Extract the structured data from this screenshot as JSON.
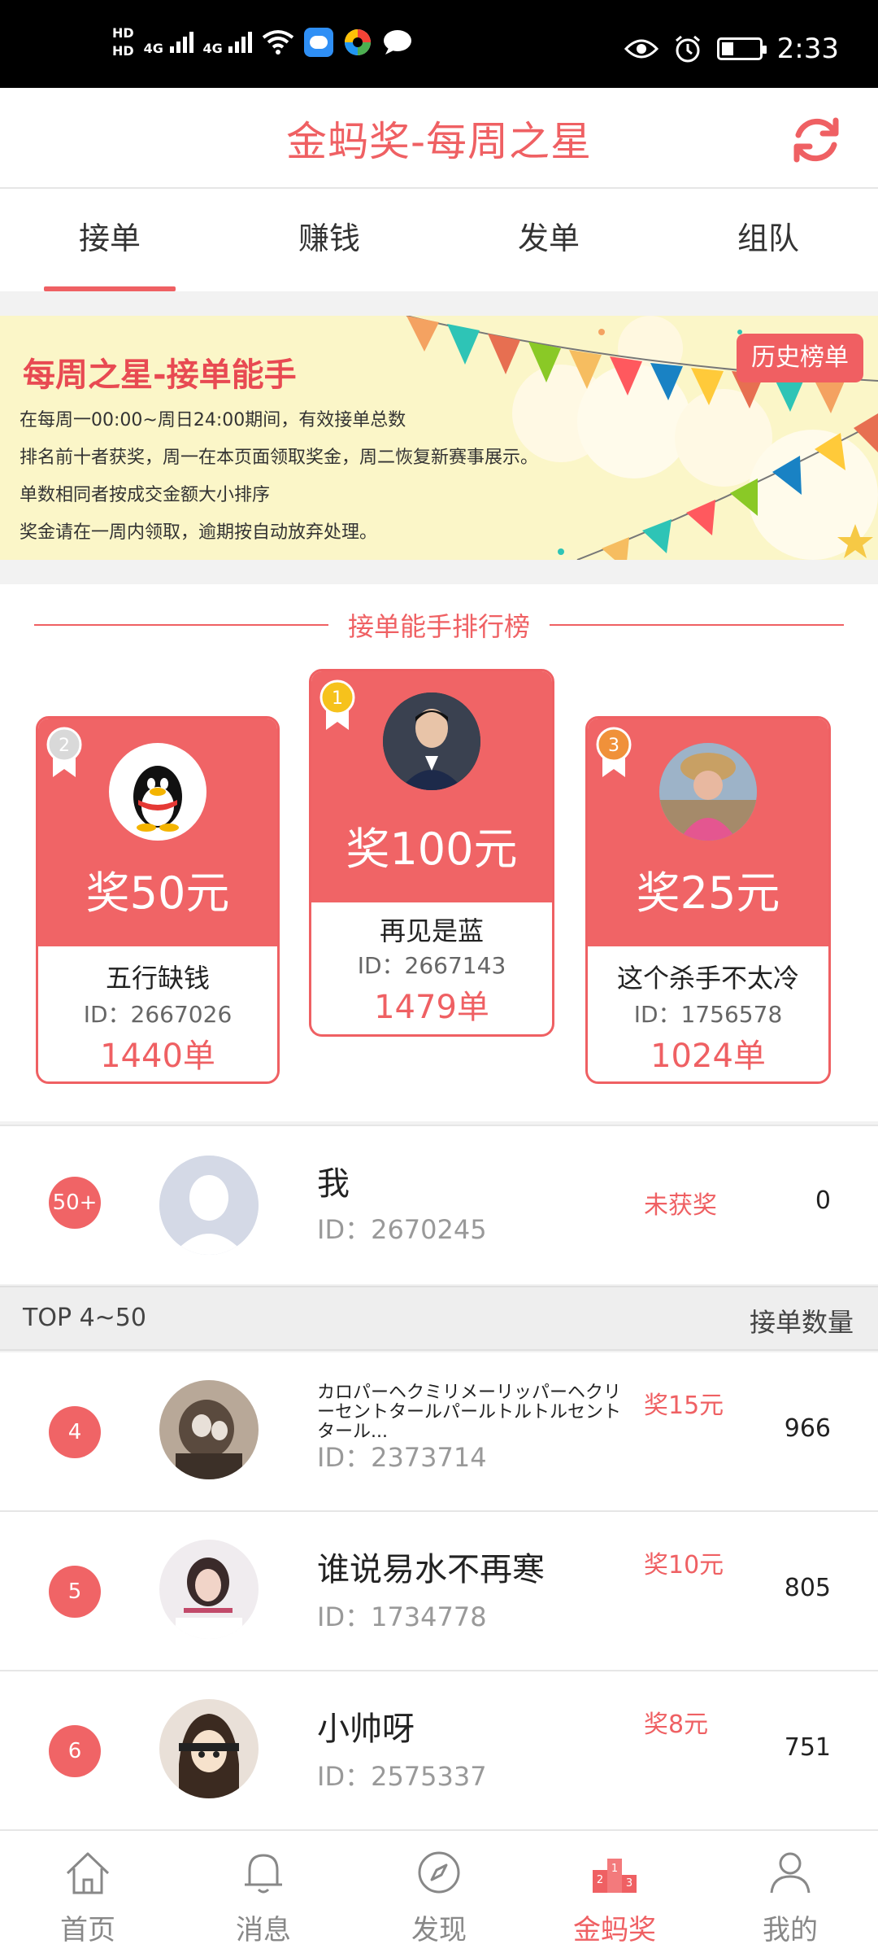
{
  "status_bar": {
    "hd1": "HD",
    "hd2": "HD",
    "net1": "4G",
    "net2": "4G",
    "time": "2:33",
    "icons": [
      "hd-icon",
      "signal-icon",
      "wifi-icon",
      "cloud-app-icon",
      "photos-app-icon",
      "chat-icon",
      "eye-icon",
      "alarm-icon",
      "battery-icon"
    ]
  },
  "header": {
    "title": "金蚂奖-每周之星",
    "refresh_icon": "refresh-icon"
  },
  "tabs": [
    {
      "label": "接单",
      "active": true
    },
    {
      "label": "赚钱"
    },
    {
      "label": "发单"
    },
    {
      "label": "组队"
    }
  ],
  "banner": {
    "title": "每周之星-接单能手",
    "history_button": "历史榜单",
    "lines": [
      "在每周一00:00~周日24:00期间，有效接单总数",
      "排名前十者获奖，周一在本页面领取奖金，周二恢复新赛事展示。",
      "单数相同者按成交金额大小排序",
      "奖金请在一周内领取，逾期按自动放弃处理。"
    ]
  },
  "ranking": {
    "title": "接单能手排行榜",
    "podium": {
      "second": {
        "rank": "2",
        "prize": "奖50元",
        "name": "五行缺钱",
        "id": "ID：2667026",
        "count": "1440单"
      },
      "first": {
        "rank": "1",
        "prize": "奖100元",
        "name": "再见是蓝",
        "id": "ID：2667143",
        "count": "1479单"
      },
      "third": {
        "rank": "3",
        "prize": "奖25元",
        "name": "这个杀手不太冷",
        "id": "ID：1756578",
        "count": "1024单"
      }
    }
  },
  "me": {
    "rank": "50+",
    "name": "我",
    "id": "ID：2670245",
    "status": "未获奖",
    "count": "0"
  },
  "list_header": {
    "left": "TOP 4~50",
    "right": "接单数量"
  },
  "list": [
    {
      "rank": "4",
      "name": "カロパーヘクミリメーリッパーヘクリーセントタールパールトルトルセントタール...",
      "id": "ID：2373714",
      "prize": "奖15元",
      "count": "966"
    },
    {
      "rank": "5",
      "name": "谁说易水不再寒",
      "id": "ID：1734778",
      "prize": "奖10元",
      "count": "805"
    },
    {
      "rank": "6",
      "name": "小帅呀",
      "id": "ID：2575337",
      "prize": "奖8元",
      "count": "751"
    }
  ],
  "bottom_nav": [
    {
      "label": "首页",
      "icon": "home-icon"
    },
    {
      "label": "消息",
      "icon": "bell-icon"
    },
    {
      "label": "发现",
      "icon": "compass-icon"
    },
    {
      "label": "金蚂奖",
      "icon": "podium-icon",
      "active": true
    },
    {
      "label": "我的",
      "icon": "profile-icon"
    }
  ],
  "colors": {
    "accent": "#ef6063",
    "podium_fill": "#f06466",
    "banner_bg": "#fbf6c8"
  }
}
